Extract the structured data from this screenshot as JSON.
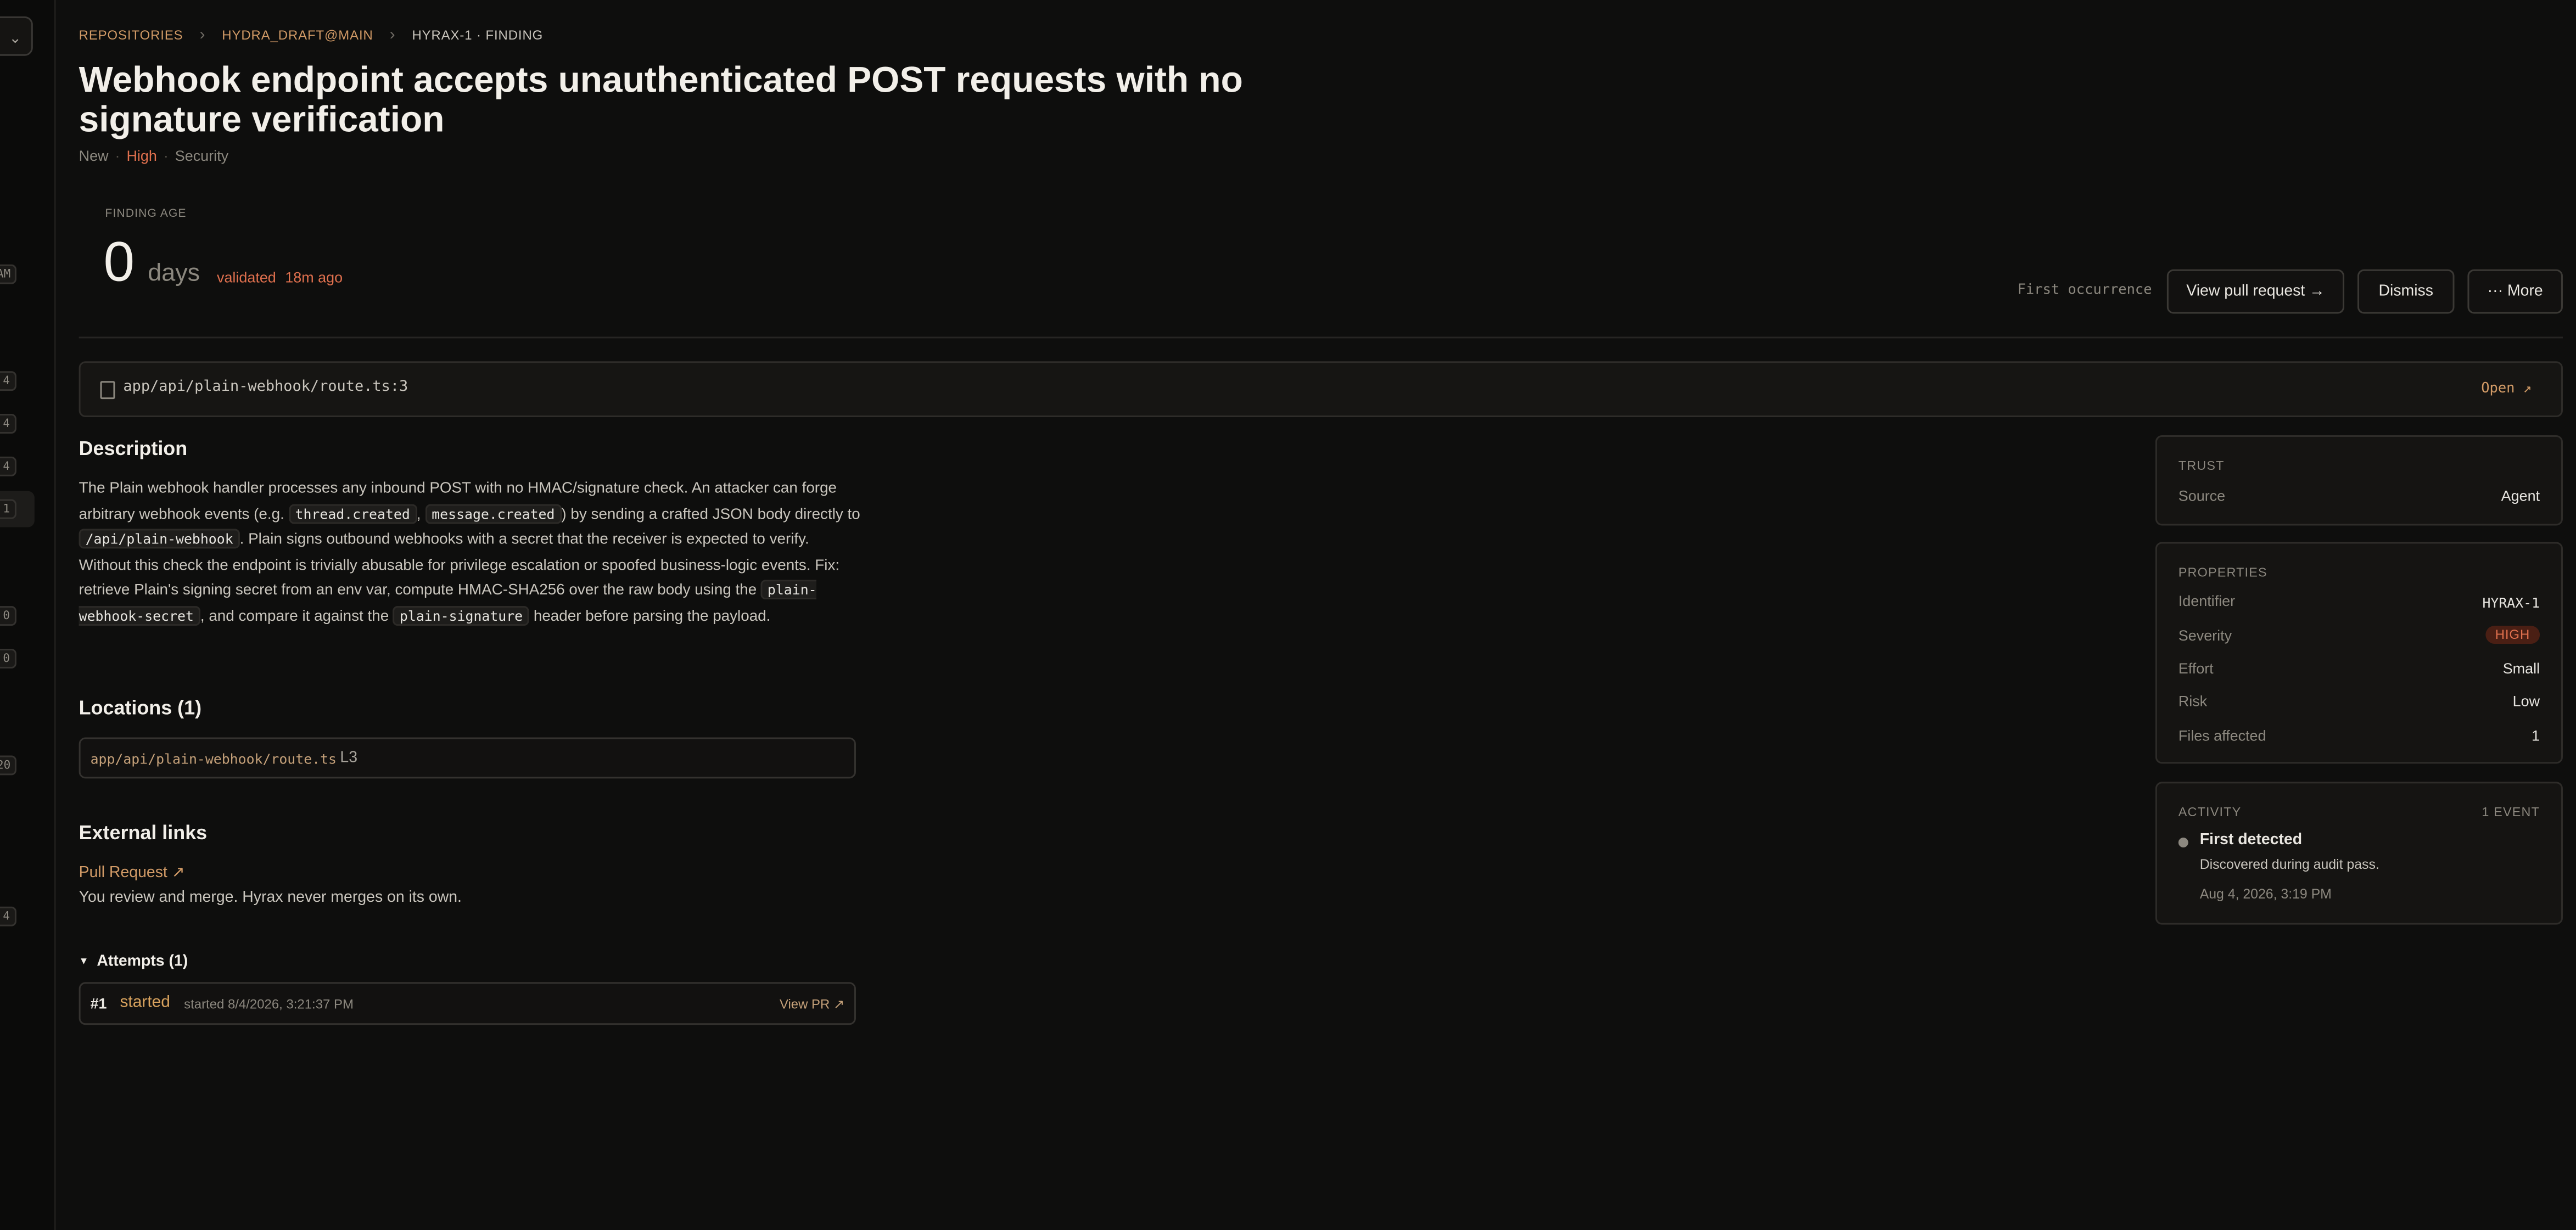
{
  "breadcrumb": {
    "items": [
      "REPOSITORIES",
      "HYDRA_DRAFT@MAIN",
      "HYRAX-1 · FINDING"
    ]
  },
  "sidebar": {
    "badges": [
      "AM",
      "4",
      "4",
      "4",
      "1",
      "0",
      "0",
      "20",
      "4"
    ]
  },
  "finding": {
    "title": "Webhook endpoint accepts unauthenticated POST requests with no signature verification",
    "status": "New",
    "severity": "High",
    "category": "Security",
    "age_label": "FINDING AGE",
    "age_value": "0",
    "age_unit": "days",
    "validated_label": "validated",
    "validated_ago": "18m ago"
  },
  "actions": {
    "first_occurrence": "First occurrence",
    "view_pr": "View pull request →",
    "dismiss": "Dismiss",
    "more": "··· More"
  },
  "file": {
    "path": "app/api/plain-webhook/route.ts:3",
    "open": "Open ↗"
  },
  "description": {
    "heading": "Description",
    "t1": "The Plain webhook handler processes any inbound POST with no HMAC/signature check. An attacker can forge arbitrary webhook events (e.g. ",
    "c1": "thread.created",
    "t2": ", ",
    "c2": "message.created",
    "t3": ") by sending a crafted JSON body directly to ",
    "c3": "/api/plain-webhook",
    "t4": ". Plain signs outbound webhooks with a secret that the receiver is expected to verify. Without this check the endpoint is trivially abusable for privilege escalation or spoofed business-logic events. Fix: retrieve Plain's signing secret from an env var, compute HMAC-SHA256 over the raw body using the ",
    "c4": "plain-webhook-secret",
    "t5": ", and compare it against the ",
    "c5": "plain-signature",
    "t6": " header before parsing the payload."
  },
  "locations": {
    "heading": "Locations (1)",
    "items": [
      {
        "path": "app/api/plain-webhook/route.ts",
        "line": "L3"
      }
    ]
  },
  "external": {
    "heading": "External links",
    "link": "Pull Request ↗",
    "note": "You review and merge. Hyrax never merges on its own."
  },
  "attempts": {
    "heading": "Attempts (1)",
    "items": [
      {
        "num": "#1",
        "status": "started",
        "time": "started 8/4/2026, 3:21:37 PM",
        "view": "View PR ↗"
      }
    ]
  },
  "trust": {
    "title": "TRUST",
    "source_label": "Source",
    "source_value": "Agent"
  },
  "properties": {
    "title": "PROPERTIES",
    "identifier_label": "Identifier",
    "identifier_value": "HYRAX-1",
    "severity_label": "Severity",
    "severity_value": "HIGH",
    "effort_label": "Effort",
    "effort_value": "Small",
    "risk_label": "Risk",
    "risk_value": "Low",
    "files_label": "Files affected",
    "files_value": "1"
  },
  "activity": {
    "title": "ACTIVITY",
    "count": "1 EVENT",
    "event_title": "First detected",
    "event_desc": "Discovered during audit pass.",
    "event_time": "Aug 4, 2026, 3:19 PM"
  },
  "colors": {
    "background": "#0e0e0d",
    "accent": "#d19a66",
    "high": "#e0704e"
  }
}
